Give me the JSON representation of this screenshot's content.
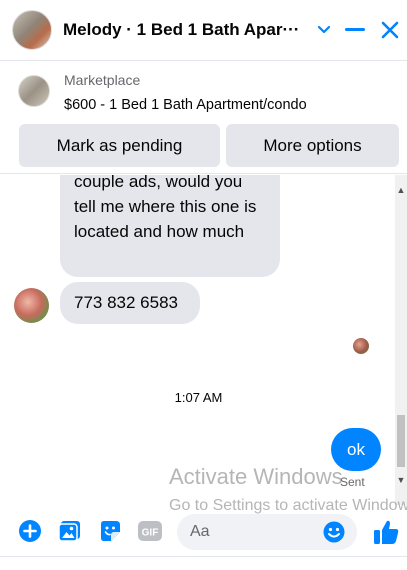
{
  "header": {
    "title": "Melody · 1 Bed 1 Bath Apar···",
    "accent_color": "#0084ff",
    "icons": [
      "chevron-down-icon",
      "minimize-icon",
      "close-icon"
    ]
  },
  "marketplace": {
    "label": "Marketplace",
    "listing_title": "$600 - 1 Bed 1 Bath Apartment/condo",
    "mark_pending_label": "Mark as pending",
    "more_options_label": "More options"
  },
  "messages": [
    {
      "direction": "incoming",
      "text": "couple ads, would you tell me where this one is located and how much"
    },
    {
      "direction": "incoming",
      "text": "773 832 6583"
    },
    {
      "direction": "outgoing",
      "text": "ok"
    }
  ],
  "timestamp": "1:07 AM",
  "sent_status": "Sent",
  "watermark": {
    "line1": "Activate Windows",
    "line2": "Go to Settings to activate Windows."
  },
  "composer": {
    "placeholder": "Aa",
    "gif_label": "GIF",
    "icons": [
      "plus-circle-icon",
      "image-icon",
      "sticker-icon",
      "gif-icon",
      "emoji-icon",
      "thumbs-up-icon"
    ]
  }
}
